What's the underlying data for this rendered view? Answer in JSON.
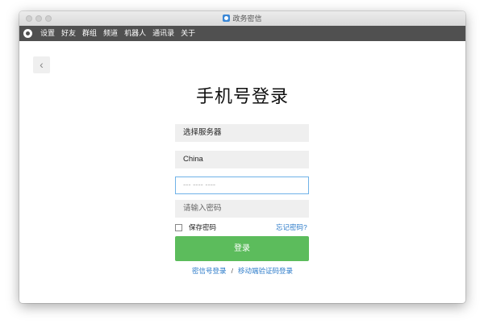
{
  "window": {
    "title": "政务密信"
  },
  "menubar": {
    "items": [
      "设置",
      "好友",
      "群组",
      "频道",
      "机器人",
      "通讯录",
      "关于"
    ]
  },
  "login": {
    "heading": "手机号登录",
    "server_select": "选择服务器",
    "country": "China",
    "phone_placeholder": "--- ---- ----",
    "password_placeholder": "请输入密码",
    "remember_label": "保存密码",
    "forgot_link": "忘记密码?",
    "submit_label": "登录",
    "alt_link_1": "密信号登录",
    "alt_separator": "/",
    "alt_link_2": "移动端验证码登录"
  },
  "colors": {
    "accent_green": "#5cbc5c",
    "link_blue": "#2a7ac9",
    "menubar_bg": "#505050",
    "focus_border": "#6fb2e8"
  }
}
